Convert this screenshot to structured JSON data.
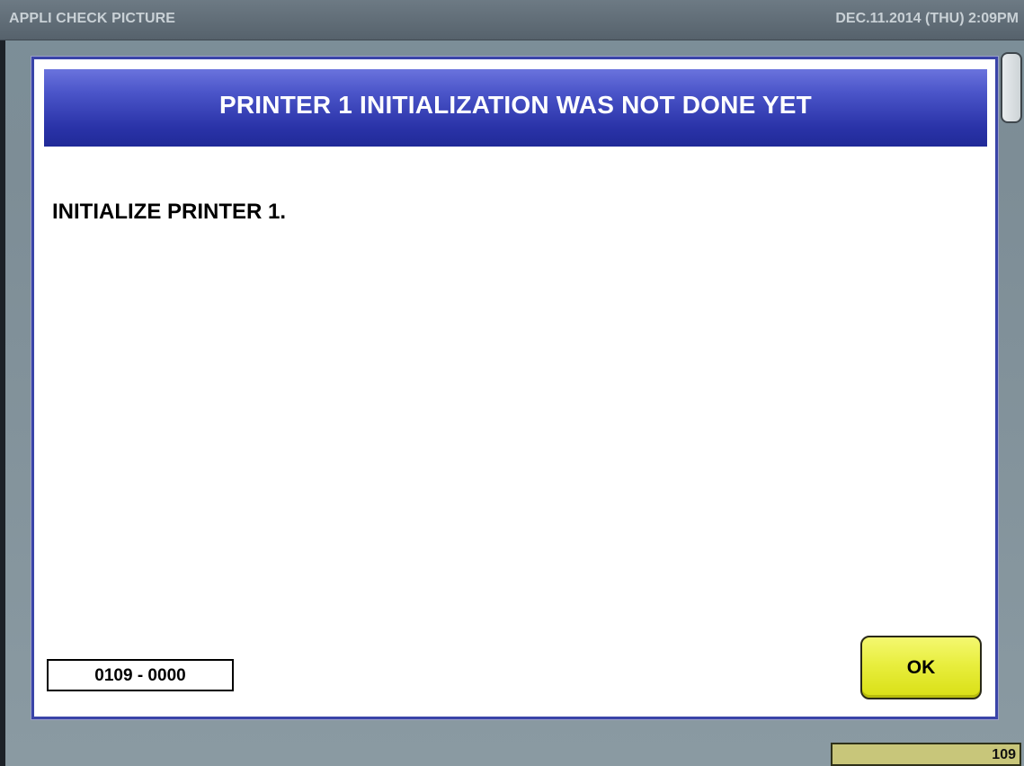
{
  "titlebar": {
    "app_title": "APPLI CHECK PICTURE",
    "datetime": "DEC.11.2014 (THU)  2:09PM"
  },
  "dialog": {
    "title": "PRINTER 1 INITIALIZATION WAS NOT DONE YET",
    "message": "INITIALIZE PRINTER 1.",
    "error_code": "0109 - 0000",
    "ok_label": "OK"
  },
  "status": {
    "counter": "109"
  },
  "colors": {
    "dialog_header": "#2a33a8",
    "ok_button": "#e8ee3e",
    "counter_bg": "#c8c67a"
  }
}
